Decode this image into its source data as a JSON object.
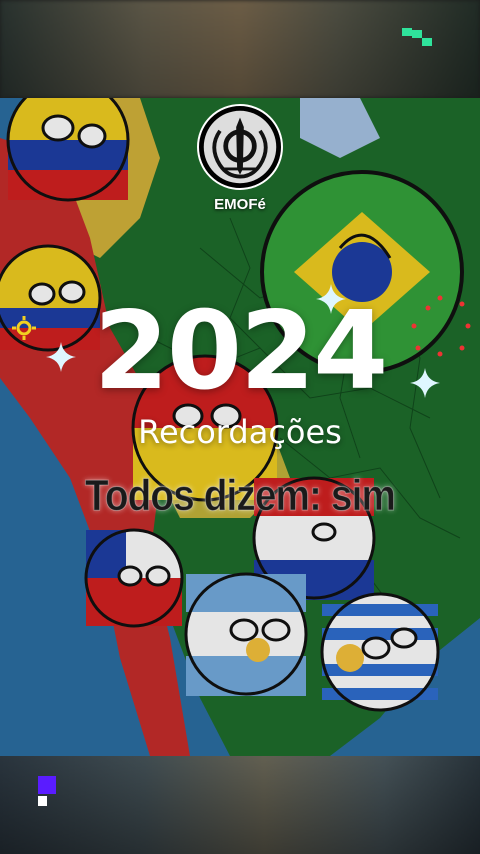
{
  "creator": {
    "username": "EMOFé",
    "avatar_icon": "khanda-icon"
  },
  "recap": {
    "year": "2024",
    "subtitle": "Recordações"
  },
  "video": {
    "caption": "Todos dizem: sim"
  },
  "colors": {
    "ocean": "#2b6fa3",
    "brazil_land": "#1f6e2c",
    "andes_red": "#c72d2b",
    "accent_green": "#2fe39b",
    "accent_purple": "#5a1cff"
  },
  "icons": [
    "green-pixel-icon",
    "purple-pixel-icon",
    "sparkle-icon",
    "sun-gear-icon"
  ]
}
